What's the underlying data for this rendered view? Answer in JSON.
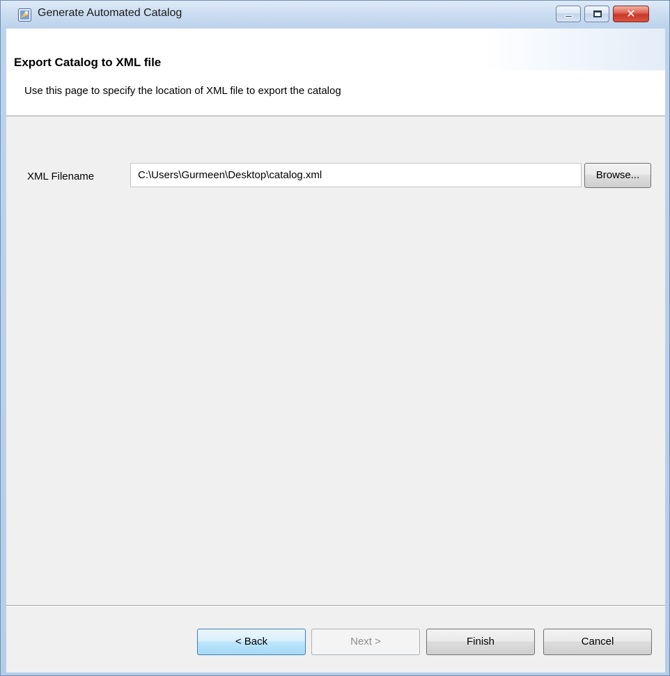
{
  "window": {
    "title": "Generate Automated Catalog",
    "buttons": {
      "minimize": "minimize",
      "maximize": "maximize",
      "close": "✕"
    }
  },
  "banner": {
    "title": "Export Catalog to XML file",
    "description": "Use this page to specify the location of XML file to export the catalog"
  },
  "form": {
    "filename_label": "XML Filename",
    "filename_value": "C:\\Users\\Gurmeen\\Desktop\\catalog.xml",
    "browse_label": "Browse..."
  },
  "footer": {
    "back_label": "< Back",
    "next_label": "Next >",
    "finish_label": "Finish",
    "cancel_label": "Cancel"
  },
  "colors": {
    "titlebar": "#c8dbf0",
    "client_bg": "#f0f0f0",
    "close_red": "#c7392a",
    "focus_blue": "#3c7fb1"
  },
  "icons": {
    "app": "eclipse-wizard-icon",
    "minimize": "minimize-icon",
    "maximize": "maximize-icon",
    "close": "close-icon"
  }
}
